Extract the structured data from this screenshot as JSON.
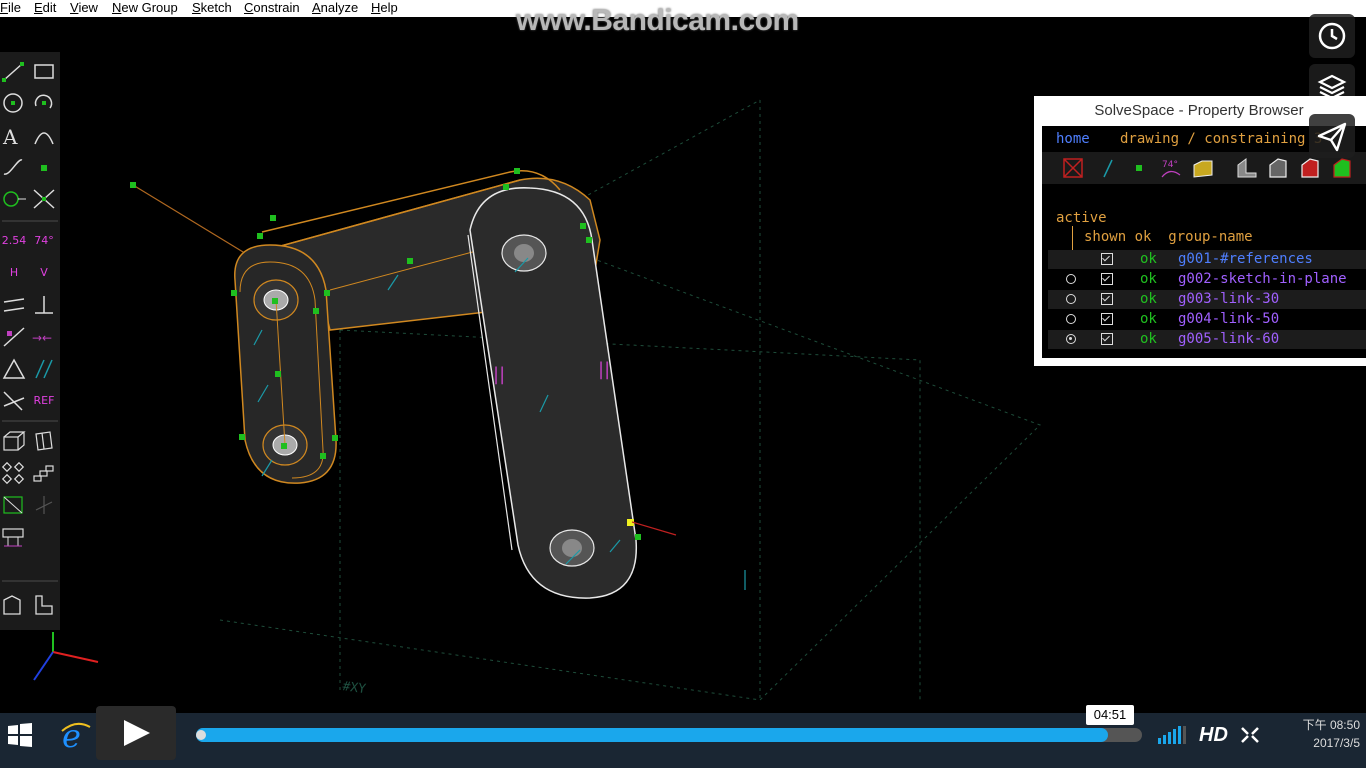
{
  "menu": [
    "File",
    "Edit",
    "View",
    "New Group",
    "Sketch",
    "Constrain",
    "Analyze",
    "Help"
  ],
  "watermark": "www.Bandicam.com",
  "toolbar": {
    "dim_label": "2.54",
    "angle_label": "74°",
    "h_label": "H",
    "v_label": "V",
    "ref_label": "REF"
  },
  "property_browser": {
    "title": "SolveSpace - Property Browser",
    "nav_home": "home",
    "nav_path": "drawing / constraining 3",
    "section_label": "active",
    "columns": "shown ok  group-name",
    "groups": [
      {
        "active": "none",
        "shown": true,
        "ok": "ok",
        "name": "g001-#references"
      },
      {
        "active": "off",
        "shown": true,
        "ok": "ok",
        "name": "g002-sketch-in-plane"
      },
      {
        "active": "off",
        "shown": true,
        "ok": "ok",
        "name": "g003-link-30"
      },
      {
        "active": "off",
        "shown": true,
        "ok": "ok",
        "name": "g004-link-50"
      },
      {
        "active": "on",
        "shown": true,
        "ok": "ok",
        "name": "g005-link-60"
      }
    ]
  },
  "viewport": {
    "plane_label": "#XY"
  },
  "player": {
    "time_tooltip": "04:51",
    "progress": 0.964,
    "quality": "HD"
  },
  "clock": {
    "time": "下午 08:50",
    "date": "2017/3/5"
  },
  "overlay_icons": [
    "clock-icon",
    "layers-icon",
    "send-icon"
  ],
  "colors": {
    "accent_blue": "#1aa7ec",
    "constraint_green": "#1fbf1f",
    "edge_orange": "#d08820"
  }
}
